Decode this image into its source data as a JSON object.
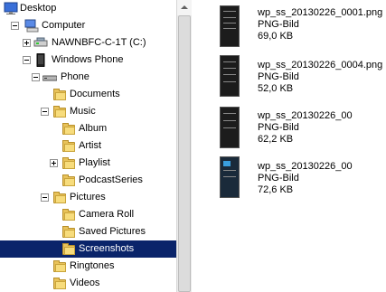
{
  "tree": {
    "items": [
      {
        "label": "Desktop",
        "icon": "desktop-icon",
        "toggle": "none"
      },
      {
        "label": "Computer",
        "icon": "computer-icon",
        "toggle": "minus"
      },
      {
        "label": "NAWNBFC-C-1T (C:)",
        "icon": "drive-icon",
        "toggle": "plus"
      },
      {
        "label": "Windows Phone",
        "icon": "phone-icon",
        "toggle": "minus"
      },
      {
        "label": "Phone",
        "icon": "phone-storage-icon",
        "toggle": "minus"
      },
      {
        "label": "Documents",
        "icon": "folder-icon",
        "toggle": "none"
      },
      {
        "label": "Music",
        "icon": "folder-icon",
        "toggle": "minus"
      },
      {
        "label": "Album",
        "icon": "folder-icon",
        "toggle": "none"
      },
      {
        "label": "Artist",
        "icon": "folder-icon",
        "toggle": "none"
      },
      {
        "label": "Playlist",
        "icon": "folder-icon",
        "toggle": "plus"
      },
      {
        "label": "PodcastSeries",
        "icon": "folder-icon",
        "toggle": "none"
      },
      {
        "label": "Pictures",
        "icon": "folder-icon",
        "toggle": "minus"
      },
      {
        "label": "Camera Roll",
        "icon": "folder-icon",
        "toggle": "none"
      },
      {
        "label": "Saved Pictures",
        "icon": "folder-icon",
        "toggle": "none"
      },
      {
        "label": "Screenshots",
        "icon": "folder-icon",
        "toggle": "none",
        "selected": true
      },
      {
        "label": "Ringtones",
        "icon": "folder-icon",
        "toggle": "none"
      },
      {
        "label": "Videos",
        "icon": "folder-icon",
        "toggle": "none"
      }
    ]
  },
  "files": [
    {
      "name": "wp_ss_20130226_0001.png",
      "type": "PNG-Bild",
      "size": "69,0 KB"
    },
    {
      "name": "wp_ss_20130226_0004.png",
      "type": "PNG-Bild",
      "size": "52,0 KB"
    },
    {
      "name": "wp_ss_20130226_00",
      "type": "PNG-Bild",
      "size": "62,2 KB"
    },
    {
      "name": "wp_ss_20130226_00",
      "type": "PNG-Bild",
      "size": "72,6 KB"
    }
  ],
  "colors": {
    "selection": "#0a246a",
    "folder": "#e8c25a"
  }
}
